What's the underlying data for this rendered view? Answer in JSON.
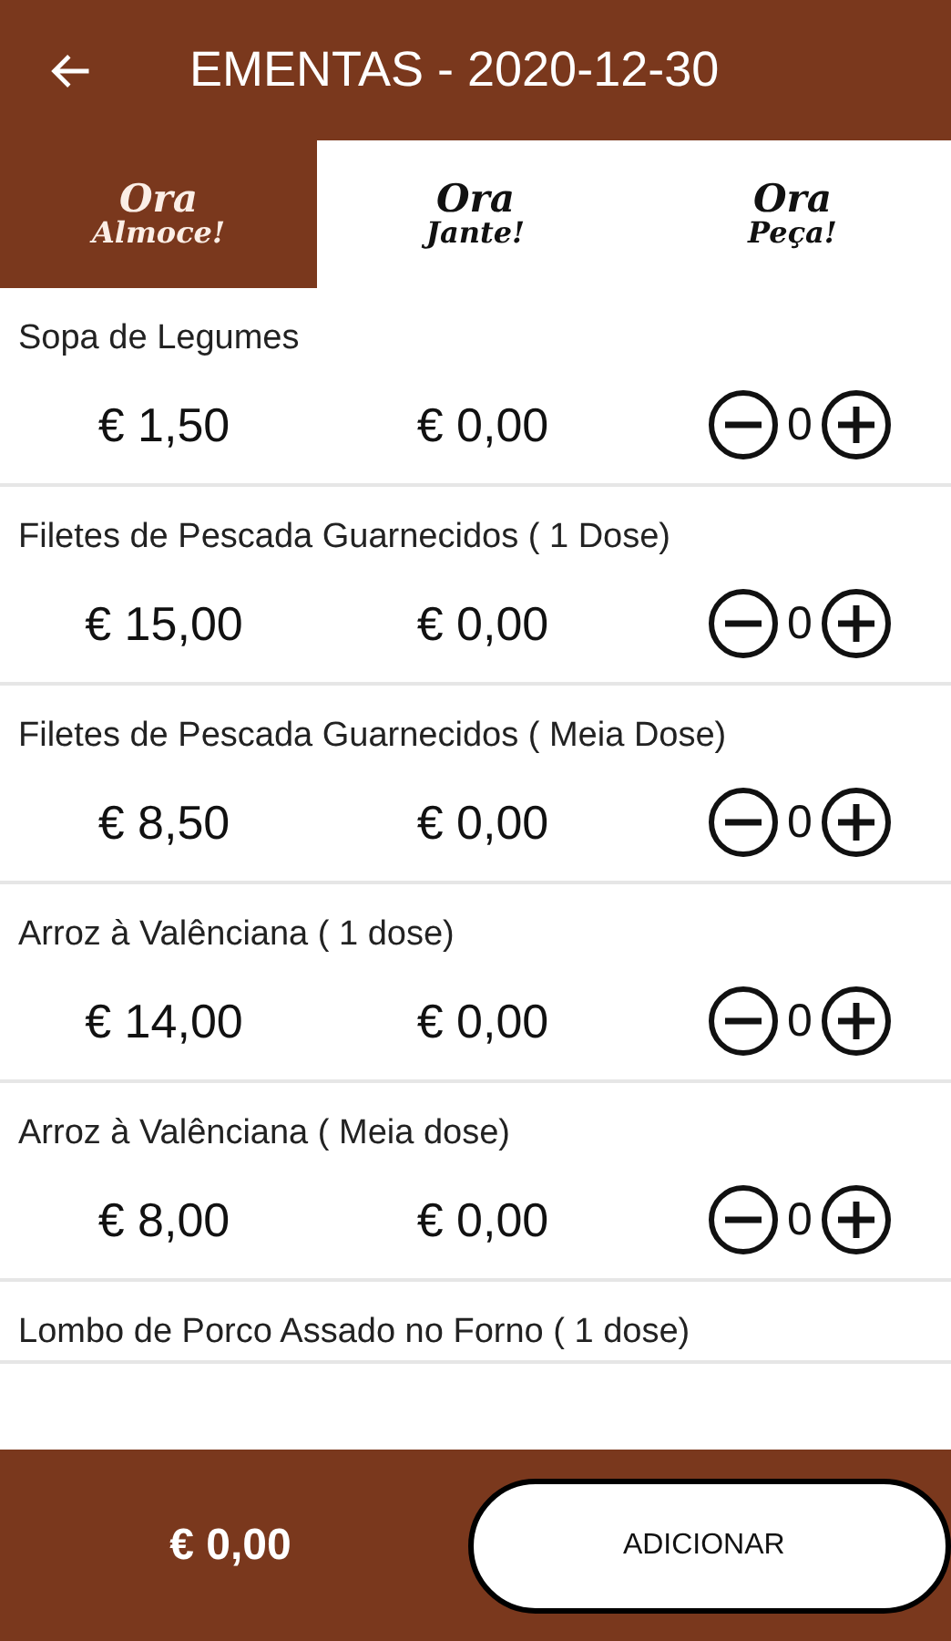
{
  "header": {
    "title": "EMENTAS - 2020-12-30"
  },
  "tabs": [
    {
      "line1": "Ora",
      "line2": "Almoce!",
      "selected": true
    },
    {
      "line1": "Ora",
      "line2": "Jante!",
      "selected": false
    },
    {
      "line1": "Ora",
      "line2": "Peça!",
      "selected": false
    }
  ],
  "items": [
    {
      "name": "Sopa de Legumes",
      "price": "€ 1,50",
      "subtotal": "€ 0,00",
      "quantity": "0"
    },
    {
      "name": "Filetes de Pescada Guarnecidos ( 1 Dose)",
      "price": "€ 15,00",
      "subtotal": "€ 0,00",
      "quantity": "0"
    },
    {
      "name": "Filetes de Pescada Guarnecidos ( Meia Dose)",
      "price": "€ 8,50",
      "subtotal": "€ 0,00",
      "quantity": "0"
    },
    {
      "name": "Arroz à Valênciana ( 1 dose)",
      "price": "€ 14,00",
      "subtotal": "€ 0,00",
      "quantity": "0"
    },
    {
      "name": "Arroz à Valênciana ( Meia dose)",
      "price": "€ 8,00",
      "subtotal": "€ 0,00",
      "quantity": "0"
    },
    {
      "name": "Lombo de Porco Assado no Forno ( 1 dose)"
    }
  ],
  "footer": {
    "total": "€ 0,00",
    "button": "ADICIONAR"
  }
}
